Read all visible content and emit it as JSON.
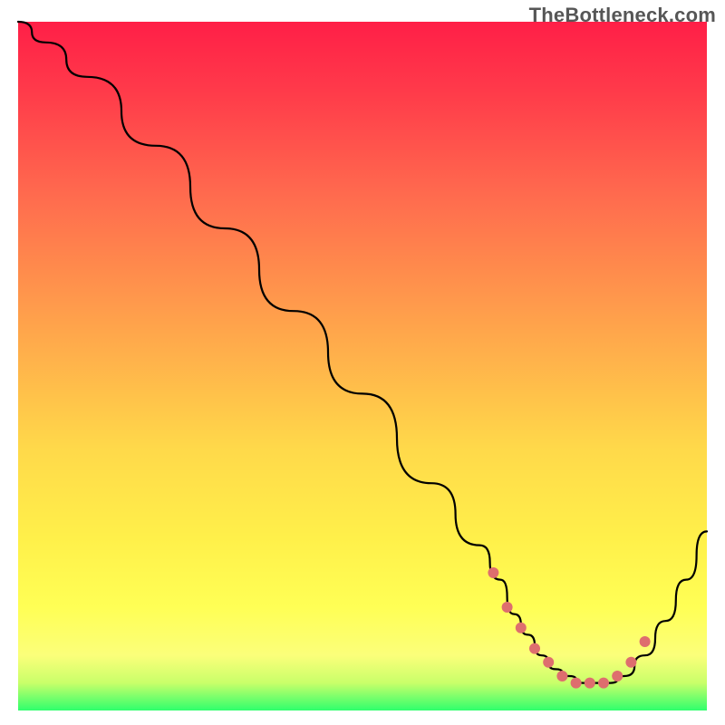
{
  "watermark": "TheBottleneck.com",
  "chart_data": {
    "type": "line",
    "title": "",
    "xlabel": "",
    "ylabel": "",
    "xlim": [
      0,
      100
    ],
    "ylim": [
      0,
      100
    ],
    "grid": false,
    "series": [
      {
        "name": "curve",
        "x": [
          0,
          4,
          10,
          20,
          30,
          40,
          50,
          60,
          67,
          70,
          72,
          74,
          76,
          78,
          80,
          82,
          84,
          86,
          88,
          91,
          94,
          97,
          100
        ],
        "values": [
          100,
          97,
          92,
          82,
          70,
          58,
          46,
          33,
          24,
          19,
          14,
          11,
          8,
          6,
          5,
          4,
          4,
          4,
          5,
          8,
          13,
          19,
          26
        ]
      }
    ],
    "markers": {
      "name": "trough-dots",
      "x": [
        69,
        71,
        73,
        75,
        77,
        79,
        81,
        83,
        85,
        87,
        89,
        91
      ],
      "values": [
        20,
        15,
        12,
        9,
        7,
        5,
        4,
        4,
        4,
        5,
        7,
        10
      ]
    },
    "background": {
      "type": "vertical-gradient",
      "stops": [
        {
          "pos": 0,
          "color": "#ff1f47"
        },
        {
          "pos": 10,
          "color": "#ff3a4a"
        },
        {
          "pos": 25,
          "color": "#ff6a4e"
        },
        {
          "pos": 45,
          "color": "#ffa64b"
        },
        {
          "pos": 62,
          "color": "#ffd94a"
        },
        {
          "pos": 75,
          "color": "#fff04a"
        },
        {
          "pos": 85,
          "color": "#ffff55"
        },
        {
          "pos": 92,
          "color": "#fbff7a"
        },
        {
          "pos": 96,
          "color": "#c9ff6a"
        },
        {
          "pos": 100,
          "color": "#2fff6d"
        }
      ]
    }
  }
}
